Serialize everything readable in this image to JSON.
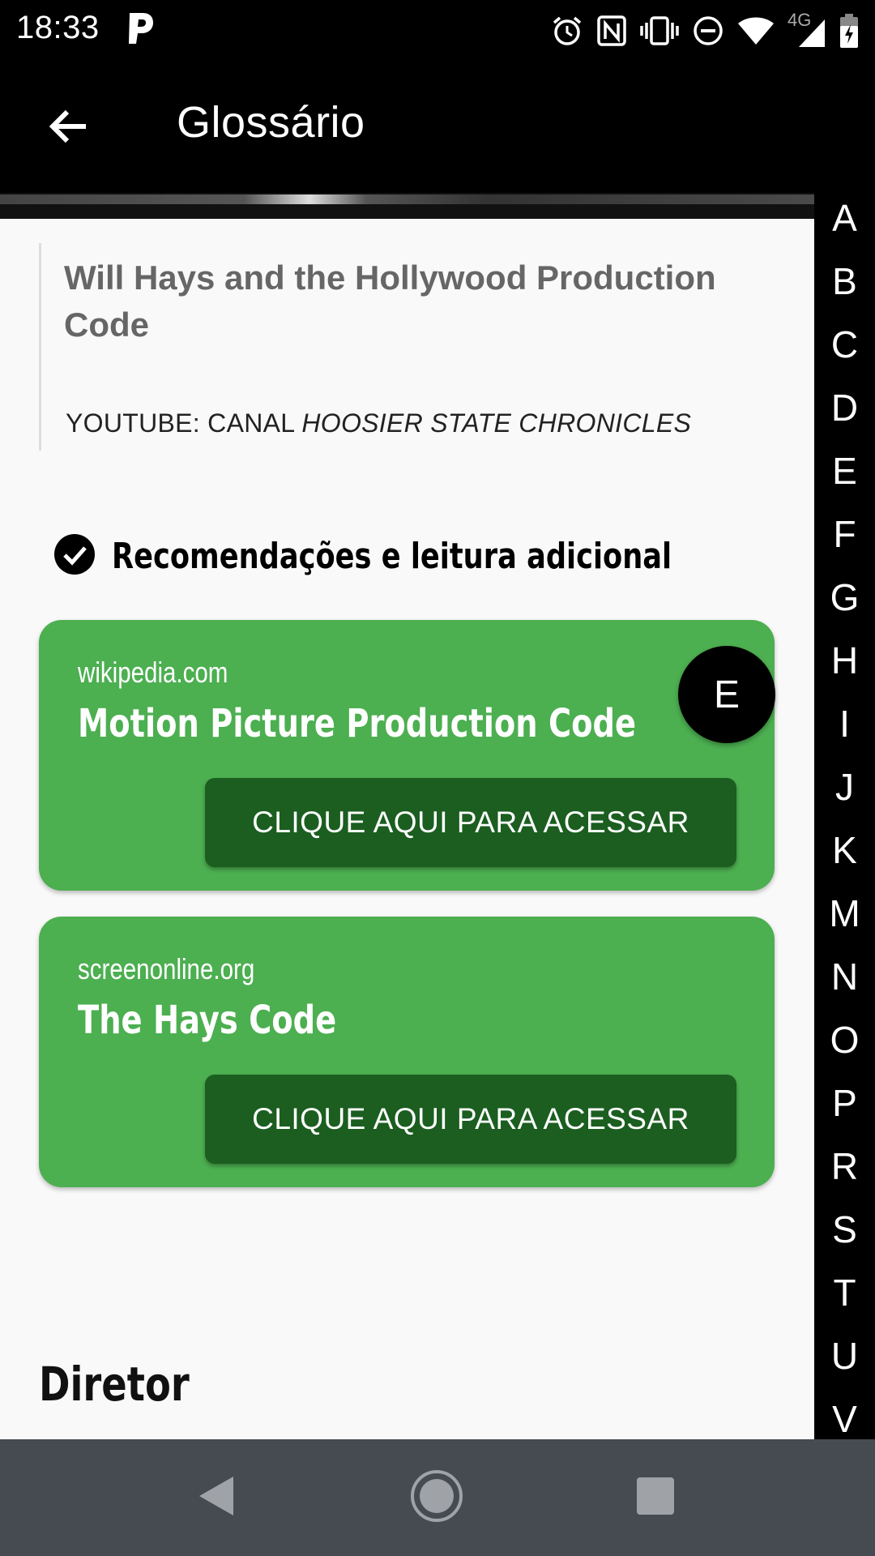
{
  "status_bar": {
    "time": "18:33",
    "network_label": "4G",
    "icons": [
      "parking-app-icon",
      "alarm-icon",
      "nfc-icon",
      "vibrate-icon",
      "do-not-disturb-icon",
      "wifi-icon",
      "cell-signal-icon",
      "battery-charging-icon"
    ]
  },
  "app_bar": {
    "title": "Glossário",
    "back_icon": "arrow-back-icon"
  },
  "quote": {
    "title": "Will Hays and the Hollywood Production Code",
    "source_prefix": "YOUTUBE: CANAL ",
    "source_channel": "HOOSIER STATE CHRONICLES"
  },
  "recommendations": {
    "heading": "Recomendações e leitura adicional",
    "cards": [
      {
        "domain": "wikipedia.com",
        "title": "Motion Picture Production Code",
        "button_label": "CLIQUE AQUI PARA ACESSAR"
      },
      {
        "domain": "screenonline.org",
        "title": "The Hays Code",
        "button_label": "CLIQUE AQUI PARA ACESSAR"
      }
    ]
  },
  "next_section": {
    "heading": "Diretor"
  },
  "current_letter": "E",
  "alphabet": [
    "A",
    "B",
    "C",
    "D",
    "E",
    "F",
    "G",
    "H",
    "I",
    "J",
    "K",
    "M",
    "N",
    "O",
    "P",
    "R",
    "S",
    "T",
    "U",
    "V"
  ],
  "colors": {
    "card_green": "#4caf50",
    "button_dark_green": "#1b5e20",
    "app_bar": "#000000",
    "nav_bar": "#454b51",
    "content_bg": "#f9f9f9"
  }
}
